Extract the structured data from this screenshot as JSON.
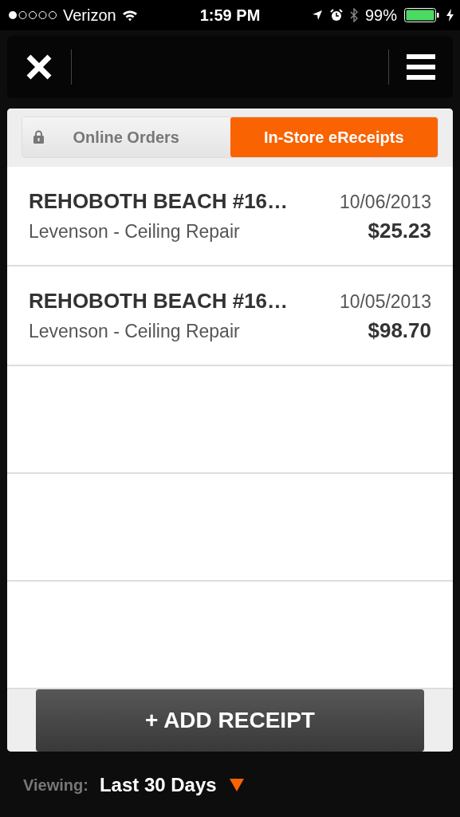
{
  "status_bar": {
    "carrier": "Verizon",
    "time": "1:59 PM",
    "battery": "99%"
  },
  "tabs": [
    {
      "label": "Online Orders",
      "selected": false,
      "locked": true
    },
    {
      "label": "In-Store eReceipts",
      "selected": true,
      "locked": false
    }
  ],
  "receipts": [
    {
      "store": "REHOBOTH BEACH #16…",
      "date": "10/06/2013",
      "description": "Levenson - Ceiling Repair",
      "amount": "$25.23"
    },
    {
      "store": "REHOBOTH BEACH #16…",
      "date": "10/05/2013",
      "description": "Levenson - Ceiling Repair",
      "amount": "$98.70"
    }
  ],
  "add_button": "+ ADD RECEIPT",
  "viewing": {
    "label": "Viewing:",
    "value": "Last 30 Days"
  }
}
